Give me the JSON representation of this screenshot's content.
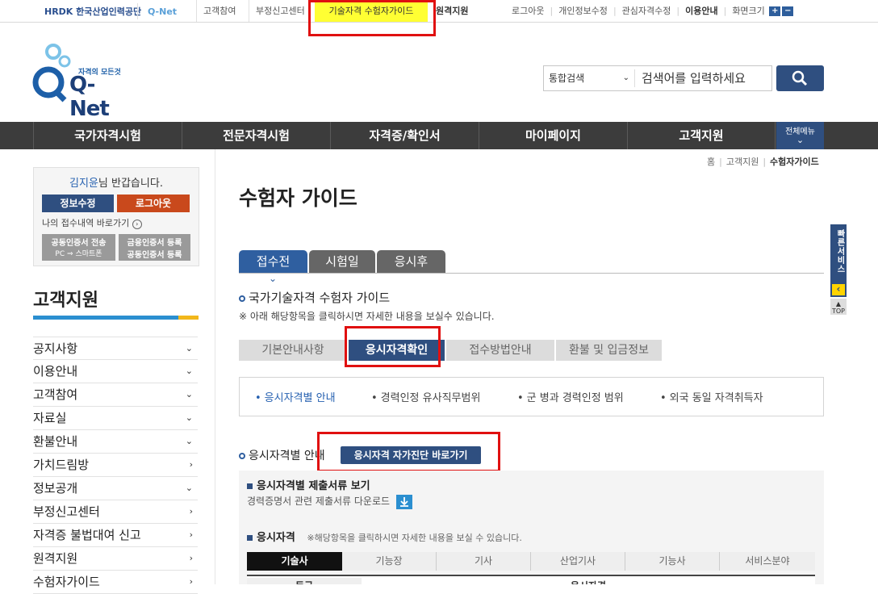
{
  "topbar": {
    "hrdk_logo": "HRDK 한국산업인력공단",
    "qnet_logo": "Q-Net",
    "links": [
      "고객참여",
      "부정신고센터",
      "기술자격 수험자가이드",
      "원격지원"
    ],
    "right_links": [
      "로그아웃",
      "개인정보수정",
      "관심자격수정",
      "이용안내",
      "화면크기"
    ],
    "zoom_plus": "+",
    "zoom_minus": "−"
  },
  "header": {
    "logo_tagline": "자격의 모든것",
    "logo_text": "Q-Net",
    "search_category": "통합검색",
    "search_placeholder": "검색어를 입력하세요"
  },
  "gnb": {
    "items": [
      "국가자격시험",
      "전문자격시험",
      "자격증/확인서",
      "마이페이지",
      "고객지원"
    ],
    "all_menu": "전체메뉴"
  },
  "login": {
    "user_name": "김지윤",
    "greeting_suffix": "님 반갑습니다.",
    "edit_button": "정보수정",
    "logout_button": "로그아웃",
    "receipt_link": "나의 접수내역 바로가기",
    "cert_send_line1": "공동인증서 전송",
    "cert_send_pc": "PC",
    "cert_send_phone": "스마트폰",
    "fin_cert_line1": "금융인증서 등록",
    "fin_cert_line2": "공동인증서 등록"
  },
  "sidebar": {
    "title": "고객지원",
    "items": [
      {
        "label": "공지사항",
        "chev": "⌄"
      },
      {
        "label": "이용안내",
        "chev": "⌄"
      },
      {
        "label": "고객참여",
        "chev": "⌄"
      },
      {
        "label": "자료실",
        "chev": "⌄"
      },
      {
        "label": "환불안내",
        "chev": "⌄"
      },
      {
        "label": "가치드림방",
        "chev": "›"
      },
      {
        "label": "정보공개",
        "chev": "⌄"
      },
      {
        "label": "부정신고센터",
        "chev": "›"
      },
      {
        "label": "자격증 불법대여 신고",
        "chev": "›"
      },
      {
        "label": "원격지원",
        "chev": "›"
      },
      {
        "label": "수험자가이드",
        "chev": "›"
      }
    ]
  },
  "breadcrumb": [
    "홈",
    "고객지원",
    "수험자가이드"
  ],
  "page_title": "수험자 가이드",
  "stage_tabs": [
    "접수전",
    "시험일",
    "응시후"
  ],
  "section_title": "국가기술자격 수험자 가이드",
  "section_note": "※ 아래 해당항목을 클릭하시면 자세한 내용을 보실수 있습니다.",
  "sub_tabs": [
    "기본안내사항",
    "응시자격확인",
    "접수방법안내",
    "환불 및 입금정보"
  ],
  "anchor_links": [
    "응시자격별 안내",
    "경력인정 유사직무범위",
    "군 병과 경력인정 범위",
    "외국 동일 자격취득자"
  ],
  "eligibility": {
    "heading": "응시자격별 안내",
    "self_check_button": "응시자격 자가진단 바로가기",
    "docs_heading": "응시자격별 제출서류 보기",
    "docs_download": "경력증명서 관련 제출서류 다운로드",
    "qual_heading": "응시자격",
    "qual_note": "※해당항목을 클릭하시면 자세한 내용을 보실 수 있습니다.",
    "grades": [
      "기술사",
      "기능장",
      "기사",
      "산업기사",
      "기능사",
      "서비스분야"
    ],
    "table_col1": "등급",
    "table_col2": "응시자격"
  },
  "quick_service": {
    "label": "빠른서비스",
    "arrow": "‹",
    "top": "TOP"
  }
}
